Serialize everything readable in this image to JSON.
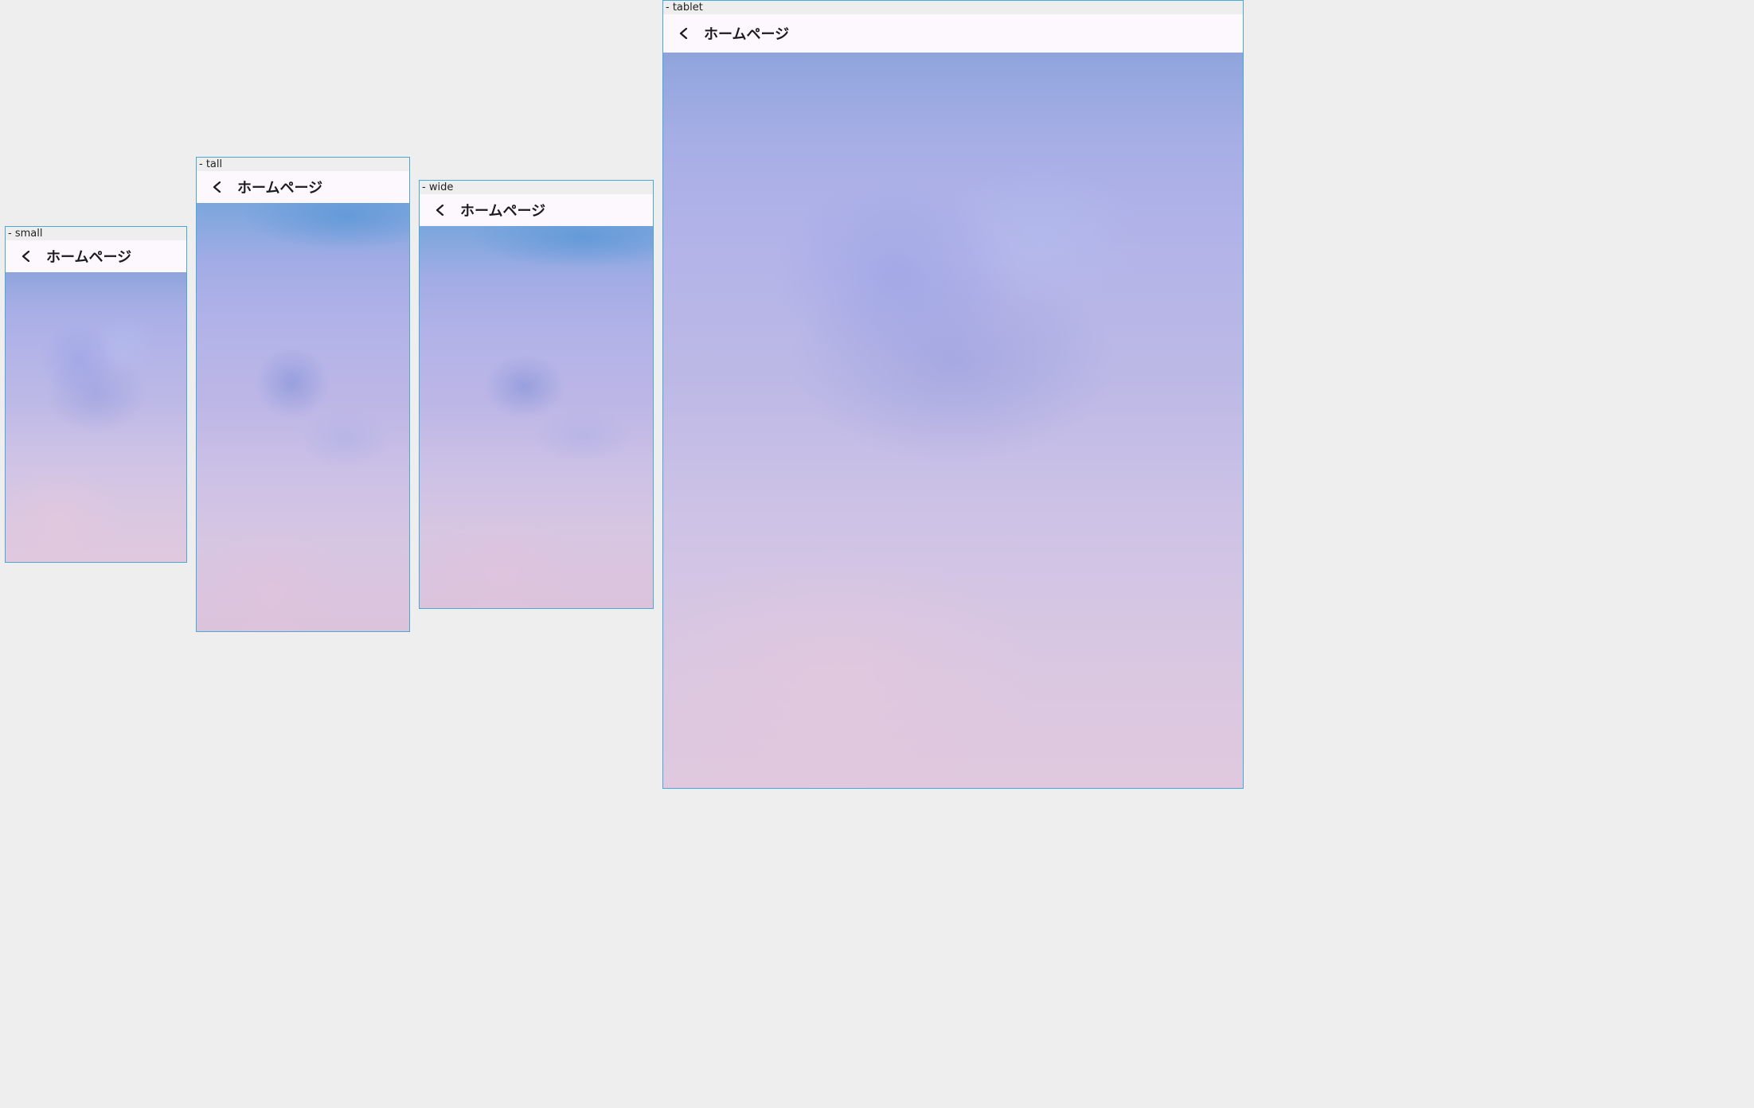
{
  "devices": [
    {
      "label": "- small",
      "title": "ホームページ",
      "back_icon": "chevron-left-icon"
    },
    {
      "label": "- tall",
      "title": "ホームページ",
      "back_icon": "chevron-left-icon"
    },
    {
      "label": "- wide",
      "title": "ホームページ",
      "back_icon": "chevron-left-icon"
    },
    {
      "label": "- tablet",
      "title": "ホームページ",
      "back_icon": "chevron-left-icon"
    }
  ],
  "colors": {
    "canvas_background": "#eeeeee",
    "device_border": "#4aa8d8",
    "app_bar_background": "#fdf7fe",
    "title_text": "#1b1b1f"
  }
}
